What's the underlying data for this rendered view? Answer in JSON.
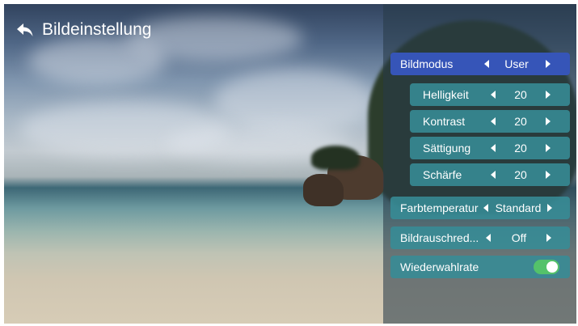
{
  "header": {
    "title": "Bildeinstellung"
  },
  "menu": {
    "bildmodus": {
      "label": "Bildmodus",
      "value": "User"
    },
    "helligkeit": {
      "label": "Helligkeit",
      "value": "20"
    },
    "kontrast": {
      "label": "Kontrast",
      "value": "20"
    },
    "saettigung": {
      "label": "Sättigung",
      "value": "20"
    },
    "schaerfe": {
      "label": "Schärfe",
      "value": "20"
    },
    "farbtemperatur": {
      "label": "Farbtemperatur",
      "value": "Standard"
    },
    "rauschred": {
      "label": "Bildrauschred...",
      "value": "Off"
    },
    "wiederwahlrate": {
      "label": "Wiederwahlrate",
      "toggle_on": true
    }
  },
  "colors": {
    "selected": "#3655b8",
    "row": "#378c96",
    "toggle_on": "#54c26a"
  }
}
